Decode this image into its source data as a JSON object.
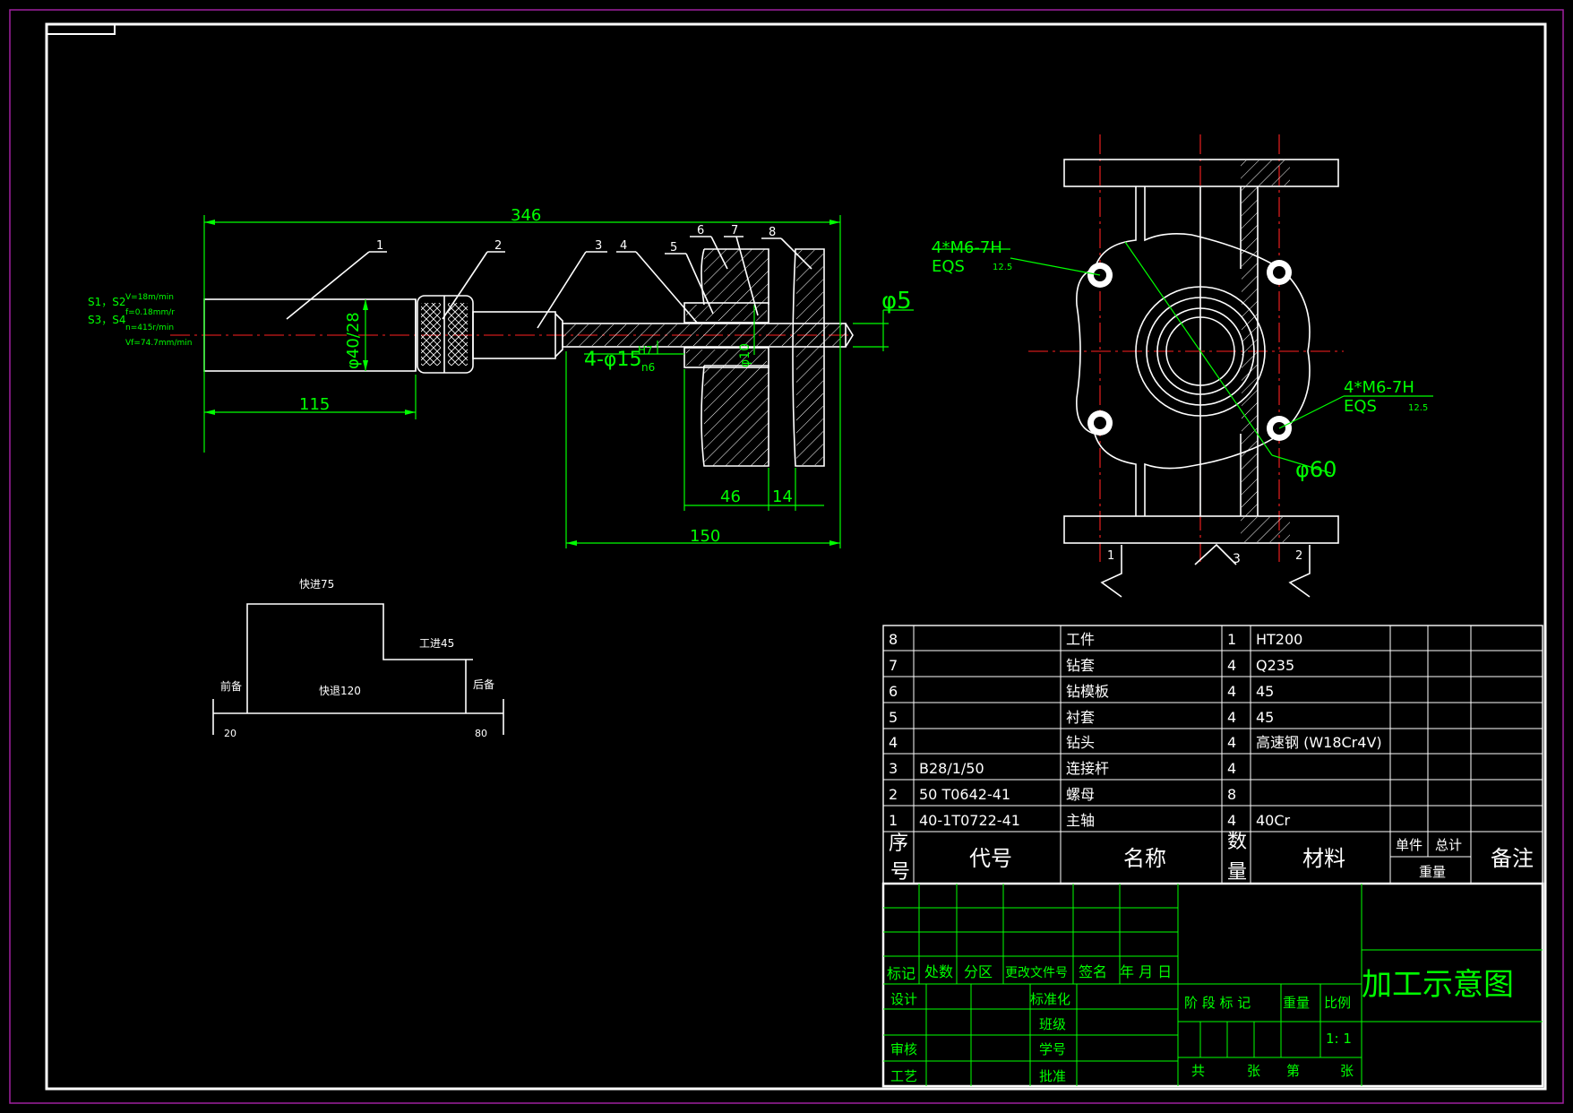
{
  "drawing": {
    "title": "加工示意图",
    "colors": {
      "border": "#ffffff",
      "dimension": "#00ff00",
      "centerline": "#ff2020",
      "frame": "#a020a0",
      "background": "#000000"
    }
  },
  "side_view": {
    "dims": {
      "overall": "346",
      "spindle_len": "115",
      "tool_len": "150",
      "plate": "46",
      "workpiece": "14",
      "spindle_dia": "φ40/28",
      "drill_dia": "φ5",
      "bushing_dia": "4-φ15",
      "fit_top": "H7",
      "fit_bottom": "n6",
      "inner_dia": "φ10"
    },
    "balloons": [
      "1",
      "2",
      "3",
      "4",
      "5",
      "6",
      "7",
      "8"
    ],
    "cutting": {
      "label_a": "S1，S2",
      "label_b": "S3，S4",
      "params": [
        "V=18m/min",
        "f=0.18mm/r",
        "n=415r/min",
        "Vf=74.7mm/min"
      ]
    }
  },
  "front_view": {
    "callout_top": "4*M6-7H",
    "callout_top_eqs": "EQS",
    "callout_top_depth": "12.5",
    "callout_bottom": "4*M6-7H",
    "callout_bottom_eqs": "EQS",
    "callout_bottom_depth": "12.5",
    "bore_dia": "φ60",
    "markers": [
      "1",
      "3",
      "2"
    ]
  },
  "cycle": {
    "fast_forward": "快进75",
    "work_feed": "工进45",
    "fast_back": "快退120",
    "front_prep": "前备",
    "rear_prep": "后备",
    "start": "20",
    "end": "80"
  },
  "parts_list": {
    "rows": [
      {
        "no": "8",
        "code": "",
        "name": "工件",
        "qty": "1",
        "material": "HT200"
      },
      {
        "no": "7",
        "code": "",
        "name": "钻套",
        "qty": "4",
        "material": "Q235"
      },
      {
        "no": "6",
        "code": "",
        "name": "钻模板",
        "qty": "4",
        "material": "45"
      },
      {
        "no": "5",
        "code": "",
        "name": "衬套",
        "qty": "4",
        "material": "45"
      },
      {
        "no": "4",
        "code": "",
        "name": "钻头",
        "qty": "4",
        "material": "高速钢 (W18Cr4V)"
      },
      {
        "no": "3",
        "code": "B28/1/50",
        "name": "连接杆",
        "qty": "4",
        "material": ""
      },
      {
        "no": "2",
        "code": "50 T0642-41",
        "name": "螺母",
        "qty": "8",
        "material": ""
      },
      {
        "no": "1",
        "code": "40-1T0722-41",
        "name": "主轴",
        "qty": "4",
        "material": "40Cr"
      }
    ],
    "header": {
      "no_a": "序",
      "no_b": "号",
      "code": "代号",
      "name": "名称",
      "qty_a": "数",
      "qty_b": "量",
      "material": "材料",
      "unit": "单件",
      "total": "总计",
      "weight": "重量",
      "remark": "备注"
    }
  },
  "title_block": {
    "mark": "标记",
    "count": "处数",
    "zone": "分区",
    "doc": "更改文件号",
    "sign": "签名",
    "date": "年 月 日",
    "design": "设计",
    "standard": "标准化",
    "class": "班级",
    "review": "审核",
    "student_no": "学号",
    "craft": "工艺",
    "approve": "批准",
    "stage": "阶 段 标 记",
    "weight": "重量",
    "scale": "比例",
    "scale_value": "1: 1",
    "sheets": "共",
    "sheets_unit": "张",
    "sheet_no": "第",
    "sheet_no_unit": "张"
  }
}
